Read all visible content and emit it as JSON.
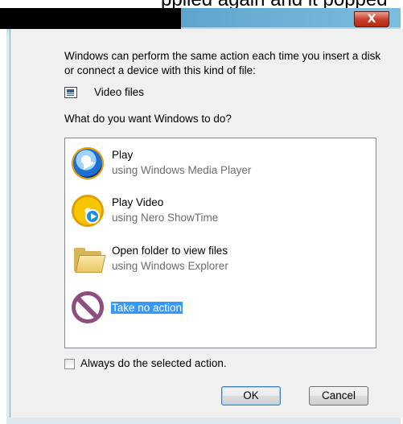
{
  "window": {
    "top_text": "pplied again and it popped",
    "close_glyph": "X"
  },
  "intro_text": "Windows can perform the same action each time you insert a disk or connect a device with this kind of file:",
  "file_type": {
    "label": "Video files",
    "icon": "video-file-icon"
  },
  "question": "What do you want Windows to do?",
  "actions": [
    {
      "name": "Play",
      "sub": "using Windows Media Player",
      "icon": "windows-media-player-icon"
    },
    {
      "name": "Play Video",
      "sub": "using Nero ShowTime",
      "icon": "nero-showtime-icon"
    },
    {
      "name": "Open folder to view files",
      "sub": "using Windows Explorer",
      "icon": "folder-icon"
    },
    {
      "name": "Take no action",
      "sub": "",
      "icon": "no-action-icon",
      "selected": true
    }
  ],
  "always_checkbox": {
    "label": "Always do the selected action.",
    "checked": false
  },
  "buttons": {
    "ok": "OK",
    "cancel": "Cancel"
  },
  "colors": {
    "selection": "#3399ff",
    "subtext": "#6d6d6d"
  }
}
